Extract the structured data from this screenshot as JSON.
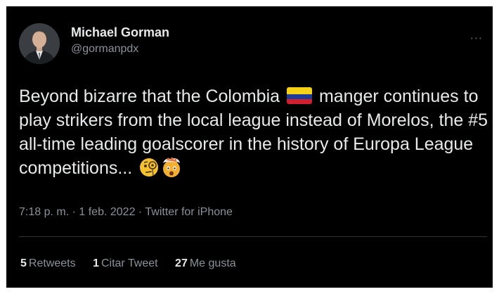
{
  "tweet": {
    "display_name": "Michael Gorman",
    "handle": "@gormanpdx",
    "more_label": "···",
    "text_part1": "Beyond bizarre that the Colombia ",
    "text_part2": " manger continues to play strikers from the local league instead of Morelos, the #5 all-time leading goalscorer in the history of Europa League competitions...",
    "flag_icon": "colombia-flag",
    "emojis": [
      "face-with-monocle",
      "exploding-head"
    ],
    "time": "7:18 p. m.",
    "date": "1 feb. 2022",
    "source": "Twitter for iPhone",
    "meta_separator": "·",
    "stats": {
      "retweets_count": "5",
      "retweets_label": "Retweets",
      "quotes_count": "1",
      "quotes_label": "Citar Tweet",
      "likes_count": "27",
      "likes_label": "Me gusta"
    }
  },
  "colors": {
    "background": "#000000",
    "primary_text": "#e7e9ea",
    "secondary_text": "#8b9199",
    "flag_yellow": "#f7d117",
    "flag_blue": "#1e3c96",
    "flag_red": "#d0202e"
  }
}
